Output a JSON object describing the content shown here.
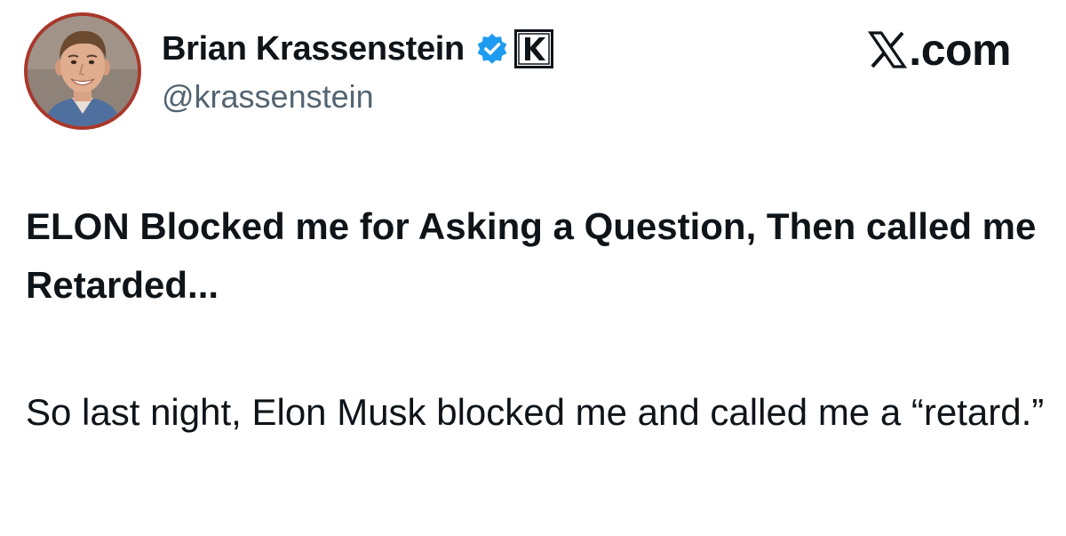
{
  "author": {
    "display_name": "Brian Krassenstein",
    "handle": "@krassenstein",
    "verified_icon": "verified-badge-icon",
    "affiliation_icon": "k-affiliation-icon",
    "avatar": "profile-photo"
  },
  "brand": {
    "logo_icon": "x-logo-icon",
    "text": ".com"
  },
  "post": {
    "headline": "ELON Blocked me for Asking a Question, Then called me Retarded...",
    "body": "So last night, Elon Musk blocked me and called me a “retard.”"
  },
  "colors": {
    "text": "#0f1419",
    "secondary_text": "#536471",
    "verified": "#1d9bf0",
    "avatar_ring": "#a8382b"
  }
}
